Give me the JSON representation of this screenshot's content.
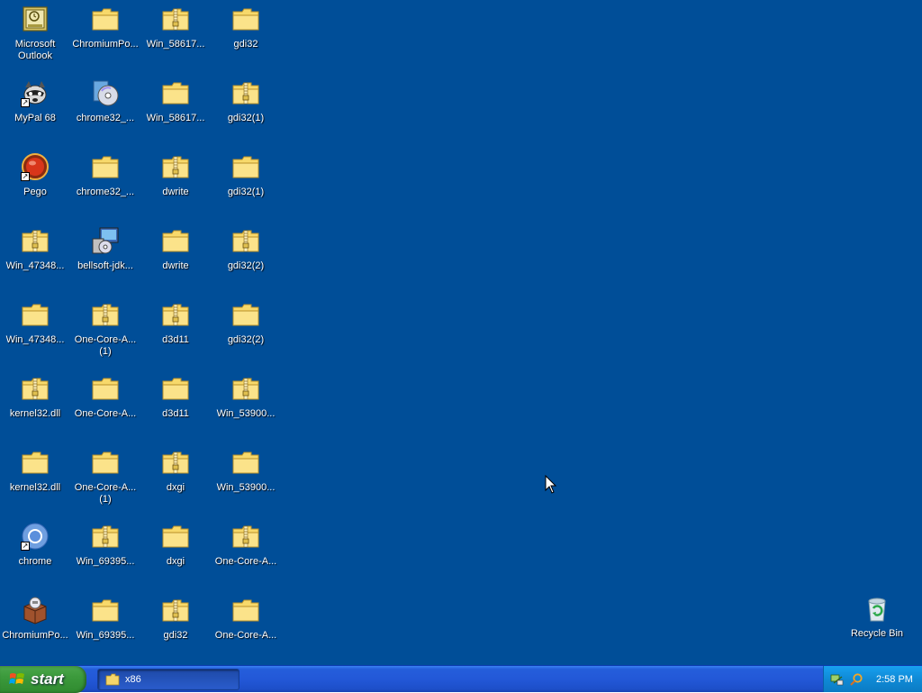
{
  "desktop": {
    "background": "#004e98",
    "icons": [
      {
        "label": "Microsoft\nOutlook",
        "type": "outlook-icon",
        "shortcut": false
      },
      {
        "label": "MyPal 68",
        "type": "raccoon-icon",
        "shortcut": true
      },
      {
        "label": "Pego",
        "type": "red-circle-icon",
        "shortcut": true
      },
      {
        "label": "Win_47348...",
        "type": "zip-folder-icon",
        "shortcut": false
      },
      {
        "label": "Win_47348...",
        "type": "folder-icon",
        "shortcut": false
      },
      {
        "label": "kernel32.dll",
        "type": "zip-folder-icon",
        "shortcut": false
      },
      {
        "label": "kernel32.dll",
        "type": "folder-icon",
        "shortcut": false
      },
      {
        "label": "chrome",
        "type": "chrome-icon",
        "shortcut": true
      },
      {
        "label": "ChromiumPo...",
        "type": "box-icon",
        "shortcut": false
      },
      {
        "label": "ChromiumPo...",
        "type": "folder-icon",
        "shortcut": false
      },
      {
        "label": "chrome32_...",
        "type": "installer-cd-icon",
        "shortcut": false
      },
      {
        "label": "chrome32_...",
        "type": "folder-icon",
        "shortcut": false
      },
      {
        "label": "bellsoft-jdk...",
        "type": "installer-pc-icon",
        "shortcut": false
      },
      {
        "label": "One-Core-A...\n(1)",
        "type": "zip-folder-icon",
        "shortcut": false
      },
      {
        "label": "One-Core-A...",
        "type": "folder-icon",
        "shortcut": false
      },
      {
        "label": "One-Core-A...\n(1)",
        "type": "folder-icon",
        "shortcut": false
      },
      {
        "label": "Win_69395...",
        "type": "zip-folder-icon",
        "shortcut": false
      },
      {
        "label": "Win_69395...",
        "type": "folder-icon",
        "shortcut": false
      },
      {
        "label": "Win_58617...",
        "type": "zip-folder-icon",
        "shortcut": false
      },
      {
        "label": "Win_58617...",
        "type": "folder-icon",
        "shortcut": false
      },
      {
        "label": "dwrite",
        "type": "zip-folder-icon",
        "shortcut": false
      },
      {
        "label": "dwrite",
        "type": "folder-icon",
        "shortcut": false
      },
      {
        "label": "d3d11",
        "type": "zip-folder-icon",
        "shortcut": false
      },
      {
        "label": "d3d11",
        "type": "folder-icon",
        "shortcut": false
      },
      {
        "label": "dxgi",
        "type": "zip-folder-icon",
        "shortcut": false
      },
      {
        "label": "dxgi",
        "type": "folder-icon",
        "shortcut": false
      },
      {
        "label": "gdi32",
        "type": "zip-folder-icon",
        "shortcut": false
      },
      {
        "label": "gdi32",
        "type": "folder-icon",
        "shortcut": false
      },
      {
        "label": "gdi32(1)",
        "type": "zip-folder-icon",
        "shortcut": false
      },
      {
        "label": "gdi32(1)",
        "type": "folder-icon",
        "shortcut": false
      },
      {
        "label": "gdi32(2)",
        "type": "zip-folder-icon",
        "shortcut": false
      },
      {
        "label": "gdi32(2)",
        "type": "folder-icon",
        "shortcut": false
      },
      {
        "label": "Win_53900...",
        "type": "zip-folder-icon",
        "shortcut": false
      },
      {
        "label": "Win_53900...",
        "type": "folder-icon",
        "shortcut": false
      },
      {
        "label": "One-Core-A...",
        "type": "zip-folder-icon",
        "shortcut": false
      },
      {
        "label": "One-Core-A...",
        "type": "folder-icon",
        "shortcut": false
      }
    ],
    "recycle_bin": {
      "label": "Recycle Bin",
      "type": "recycle-bin-icon"
    }
  },
  "taskbar": {
    "start_label": "start",
    "tasks": [
      {
        "label": "x86",
        "icon": "folder-icon"
      }
    ],
    "tray_icons": [
      "network-icon",
      "search-icon"
    ],
    "clock": "2:58 PM"
  }
}
